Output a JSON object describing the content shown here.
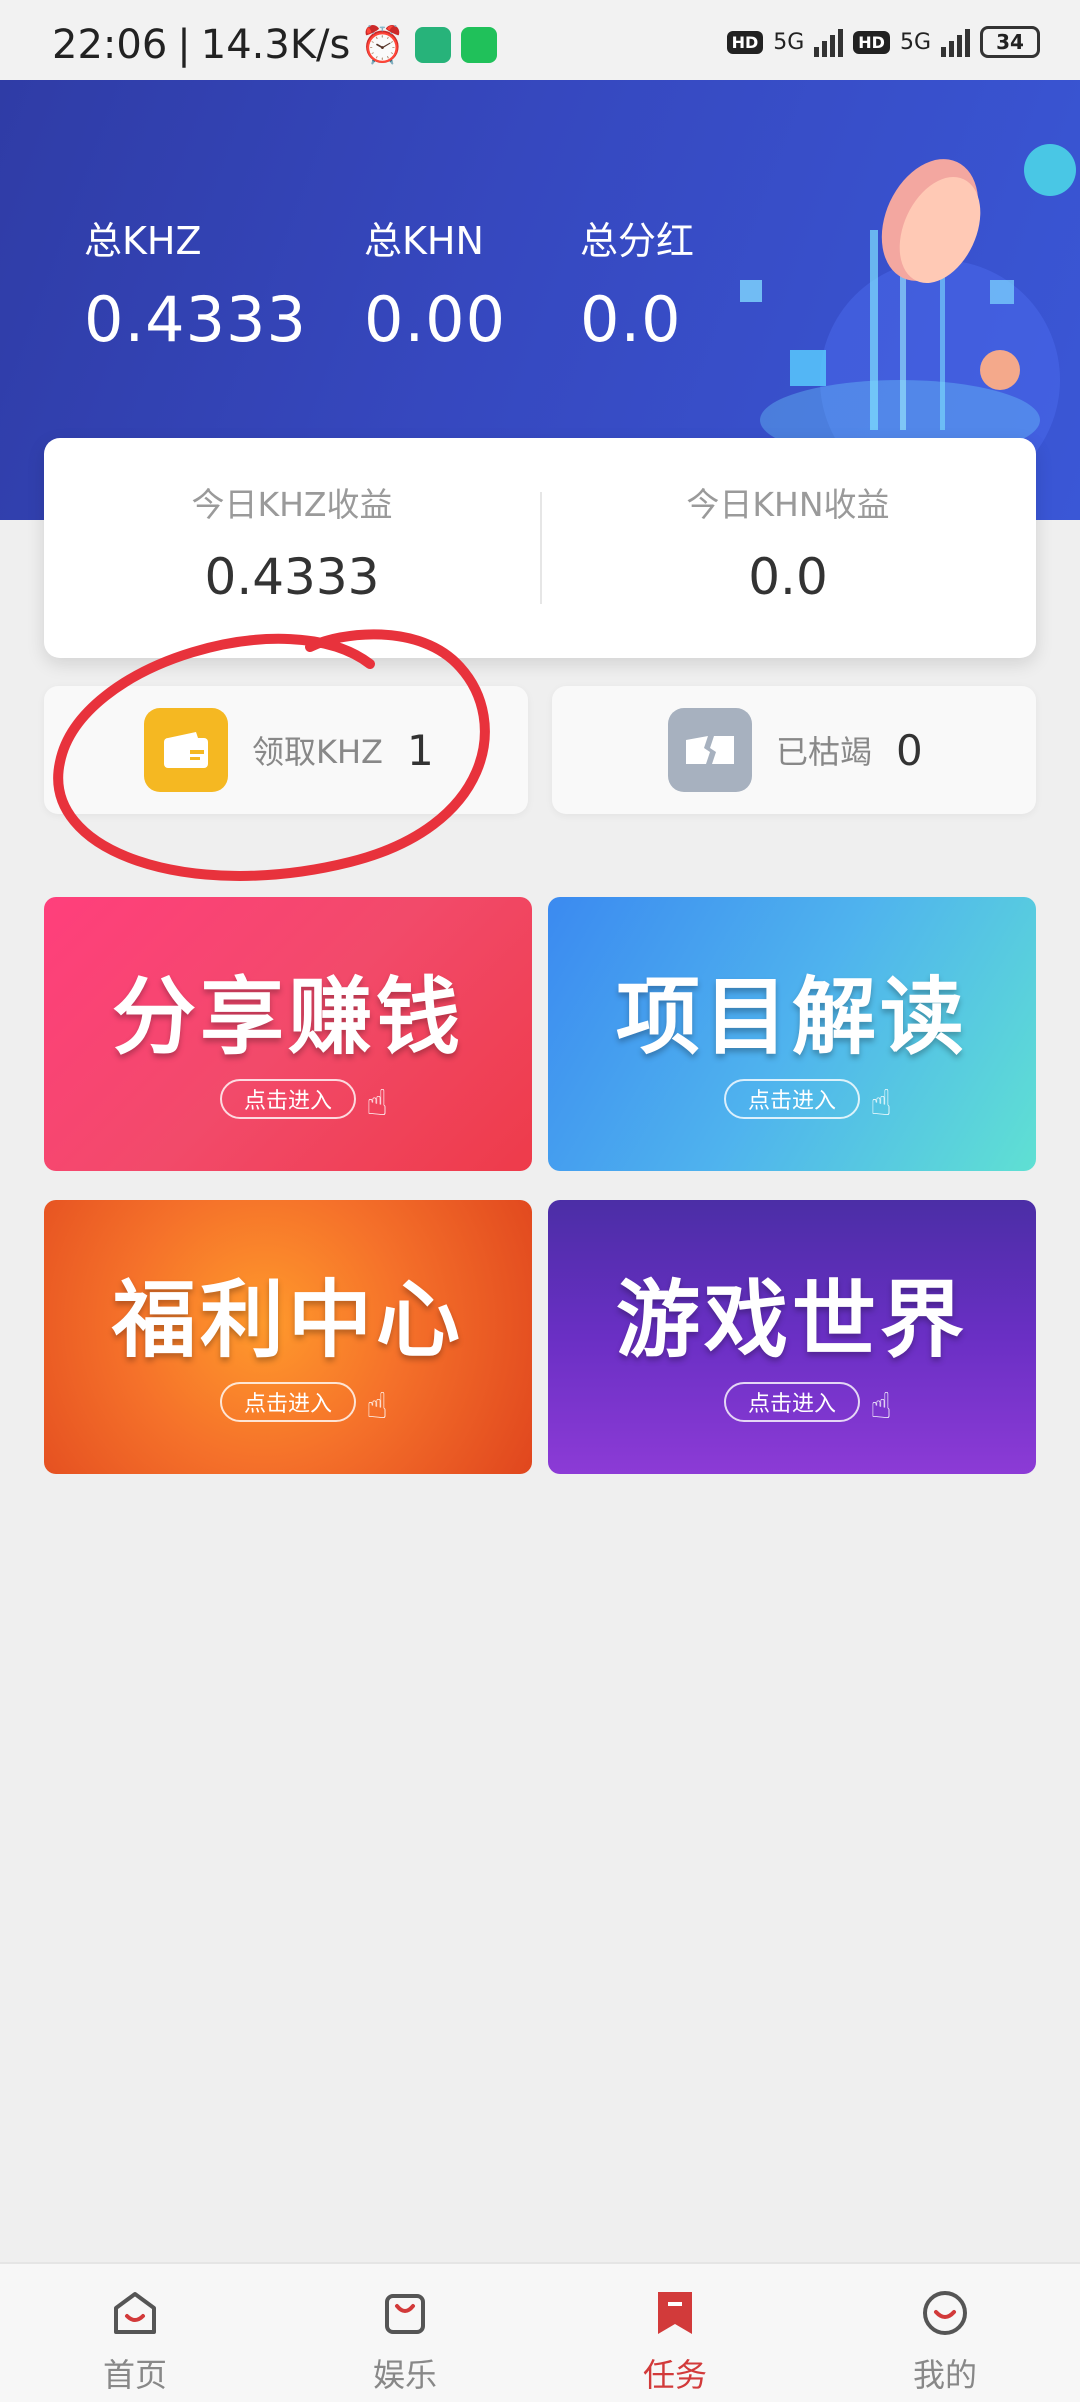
{
  "status_bar": {
    "time": "22:06",
    "net_speed": "14.3K/s",
    "signal_1": "5G",
    "signal_2": "5G",
    "hd_1": "HD",
    "hd_2": "HD",
    "battery": "34"
  },
  "header": {
    "stats": [
      {
        "label": "总KHZ",
        "value": "0.4333"
      },
      {
        "label": "总KHN",
        "value": "0.00"
      },
      {
        "label": "总分红",
        "value": "0.0"
      }
    ]
  },
  "today": {
    "khz_label": "今日KHZ收益",
    "khz_value": "0.4333",
    "khn_label": "今日KHN收益",
    "khn_value": "0.0"
  },
  "mini_cards": {
    "claim": {
      "label": "领取KHZ",
      "count": "1"
    },
    "exhausted": {
      "label": "已枯竭",
      "count": "0"
    }
  },
  "tiles": [
    {
      "title": "分享赚钱",
      "enter": "点击进入"
    },
    {
      "title": "项目解读",
      "enter": "点击进入"
    },
    {
      "title": "福利中心",
      "enter": "点击进入"
    },
    {
      "title": "游戏世界",
      "enter": "点击进入"
    }
  ],
  "nav": {
    "items": [
      {
        "label": "首页",
        "icon": "home-icon"
      },
      {
        "label": "娱乐",
        "icon": "shopping-bag-icon"
      },
      {
        "label": "任务",
        "icon": "bookmark-icon"
      },
      {
        "label": "我的",
        "icon": "profile-smile-icon"
      }
    ],
    "active_index": 2
  },
  "colors": {
    "accent_red": "#d23a3a",
    "header_blue": "#3648bf",
    "annotation_red": "#e8323c"
  }
}
